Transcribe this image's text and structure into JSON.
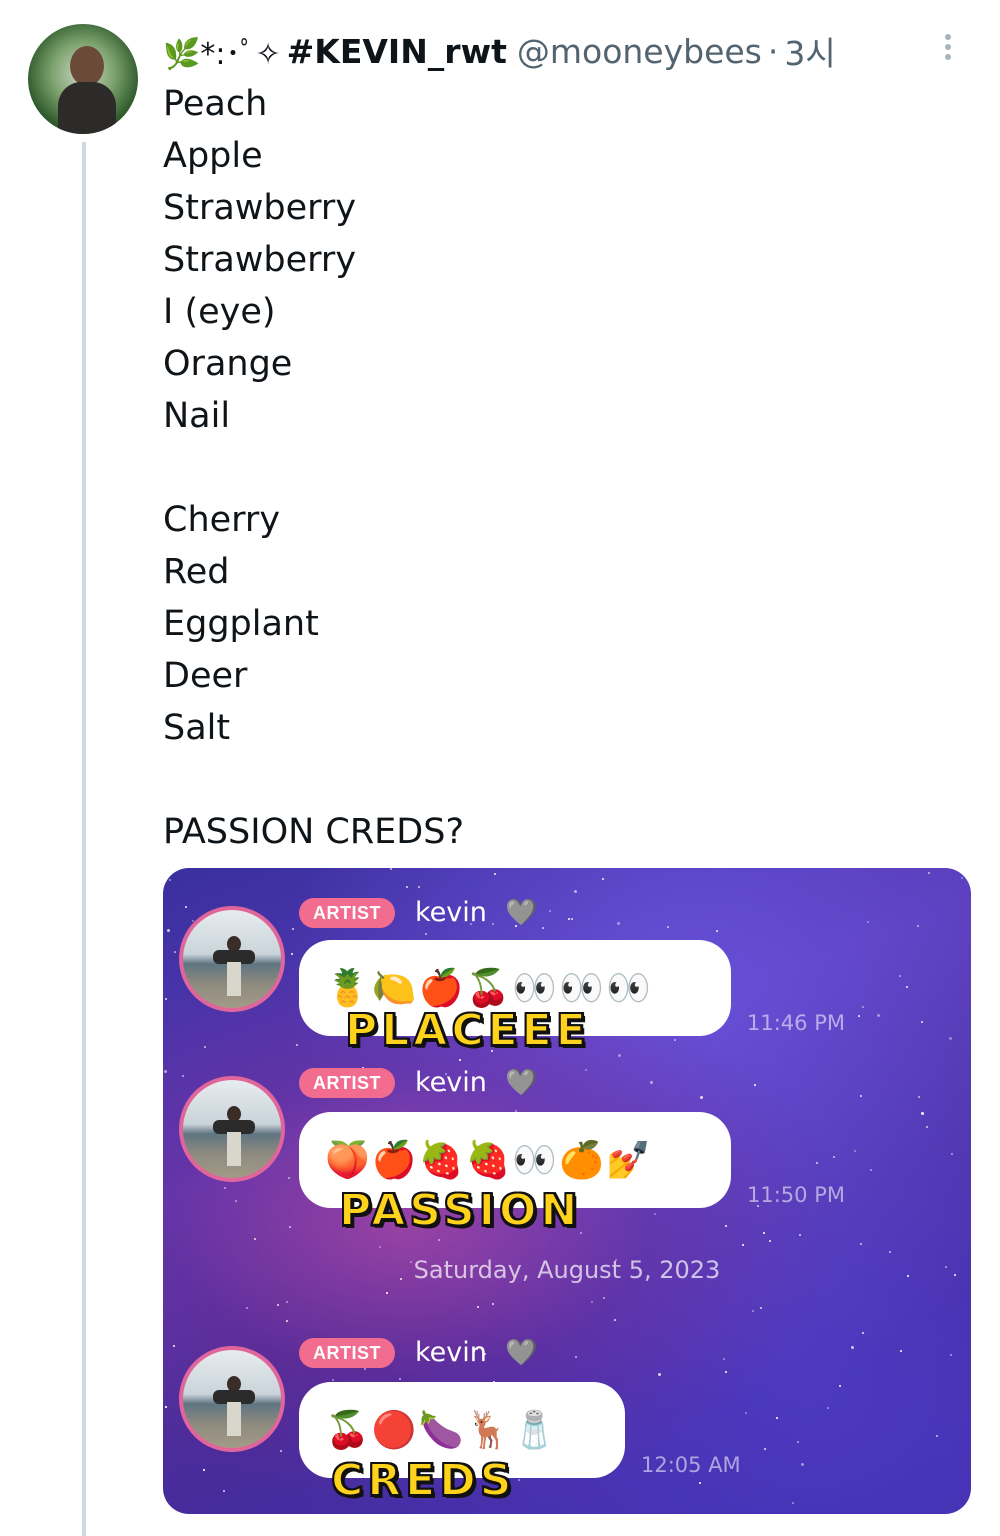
{
  "tweet": {
    "decoration": "🌿*:･ﾟ✧",
    "display_name": "#KEVIN_rwt",
    "handle": "@mooneybees",
    "time": "3시",
    "lines": [
      "Peach",
      "Apple",
      "Strawberry",
      "Strawberry",
      "I (eye)",
      "Orange",
      "Nail",
      "",
      "Cherry",
      "Red",
      "Eggplant",
      "Deer",
      "Salt",
      "",
      "PASSION CREDS?"
    ]
  },
  "media": {
    "messages": [
      {
        "badge": "ARTIST",
        "name": "kevin",
        "heart": "🩶",
        "emojis": "🍍🍋🍎🍒👀👀👀",
        "time": "11:46 PM",
        "caption": "PLACEEE"
      },
      {
        "badge": "ARTIST",
        "name": "kevin",
        "heart": "🩶",
        "emojis": "🍑🍎🍓🍓👀🍊💅",
        "time": "11:50 PM",
        "caption": "PASSION"
      },
      {
        "badge": "ARTIST",
        "name": "kevin",
        "heart": "🩶",
        "emojis": "🍒🔴🍆🦌🧂",
        "time": "12:05 AM",
        "caption": "CREDS"
      }
    ],
    "date_separator": "Saturday, August 5, 2023"
  },
  "colors": {
    "badge": "#f16c8e",
    "caption_yellow": "#ffd21c",
    "avatar_ring": "#e0659b",
    "thread_line": "#cfd9de"
  }
}
